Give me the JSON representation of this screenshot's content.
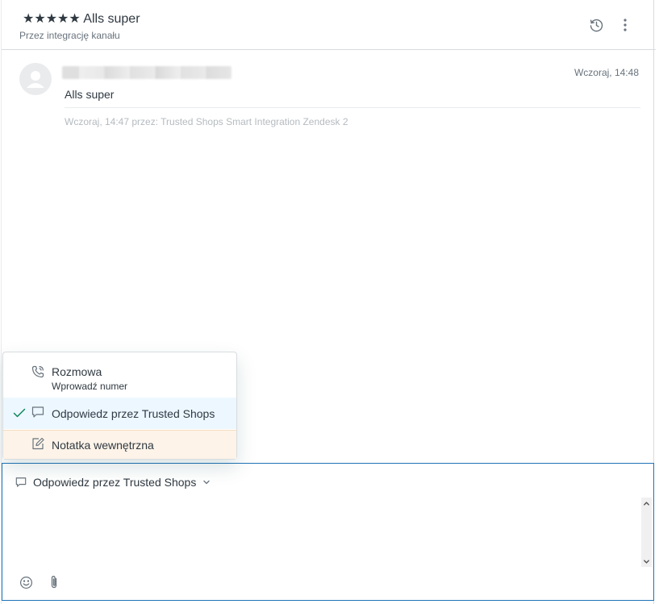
{
  "ticket": {
    "title": "★★★★★ Alls super",
    "subtitle": "Przez integrację kanału"
  },
  "header_icons": [
    "history-icon",
    "more-vertical-icon"
  ],
  "message": {
    "time": "Wczoraj, 14:48",
    "body": "Alls super",
    "meta": "Wczoraj, 14:47 przez: Trusted Shops Smart Integration Zendesk 2"
  },
  "channel_menu": {
    "items": [
      {
        "label": "Rozmowa",
        "hint": "Wprowadź numer",
        "icon": "phone-icon",
        "selected": false
      },
      {
        "label": "Odpowiedz przez Trusted Shops",
        "icon": "speech-bubble-icon",
        "selected": true
      },
      {
        "label": "Notatka wewnętrzna",
        "icon": "note-edit-icon",
        "selected": false
      }
    ]
  },
  "composer": {
    "channel_label": "Odpowiedz przez Trusted Shops",
    "footer_icons": [
      "emoji-icon",
      "paperclip-icon"
    ]
  },
  "colors": {
    "accent": "#1f73b7",
    "selected_bg": "#edf7ff",
    "note_bg": "#fdf3e8",
    "check": "#038153"
  }
}
